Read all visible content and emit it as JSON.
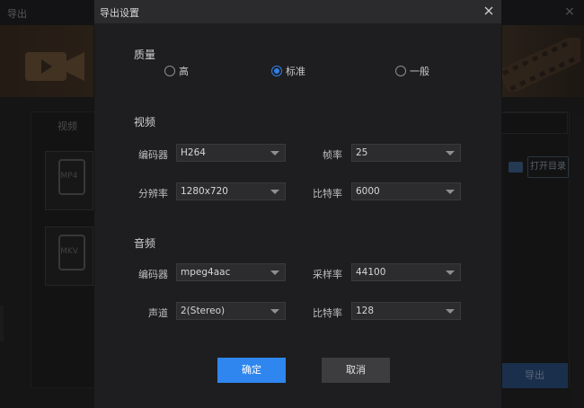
{
  "background_window": {
    "title": "导出",
    "close_icon": "×",
    "tab_label": "视频",
    "formats": [
      "MP4",
      "MKV"
    ],
    "open_dir_label": "打开目录",
    "export_label": "导出"
  },
  "dialog": {
    "title": "导出设置",
    "close_icon": "close-icon",
    "quality": {
      "title": "质量",
      "options": [
        "高",
        "标准",
        "一般"
      ],
      "selected": "标准"
    },
    "video": {
      "title": "视频",
      "encoder_label": "编码器",
      "encoder_value": "H264",
      "framerate_label": "帧率",
      "framerate_value": "25",
      "resolution_label": "分辨率",
      "resolution_value": "1280x720",
      "bitrate_label": "比特率",
      "bitrate_value": "6000"
    },
    "audio": {
      "title": "音频",
      "encoder_label": "编码器",
      "encoder_value": "mpeg4aac",
      "samplerate_label": "采样率",
      "samplerate_value": "44100",
      "channel_label": "声道",
      "channel_value": "2(Stereo)",
      "bitrate_label": "比特率",
      "bitrate_value": "128"
    },
    "confirm_label": "确定",
    "cancel_label": "取消"
  },
  "colors": {
    "accent": "#2f86ee",
    "dialog_bg": "#1e1e20",
    "select_bg": "#2c2c2e"
  }
}
